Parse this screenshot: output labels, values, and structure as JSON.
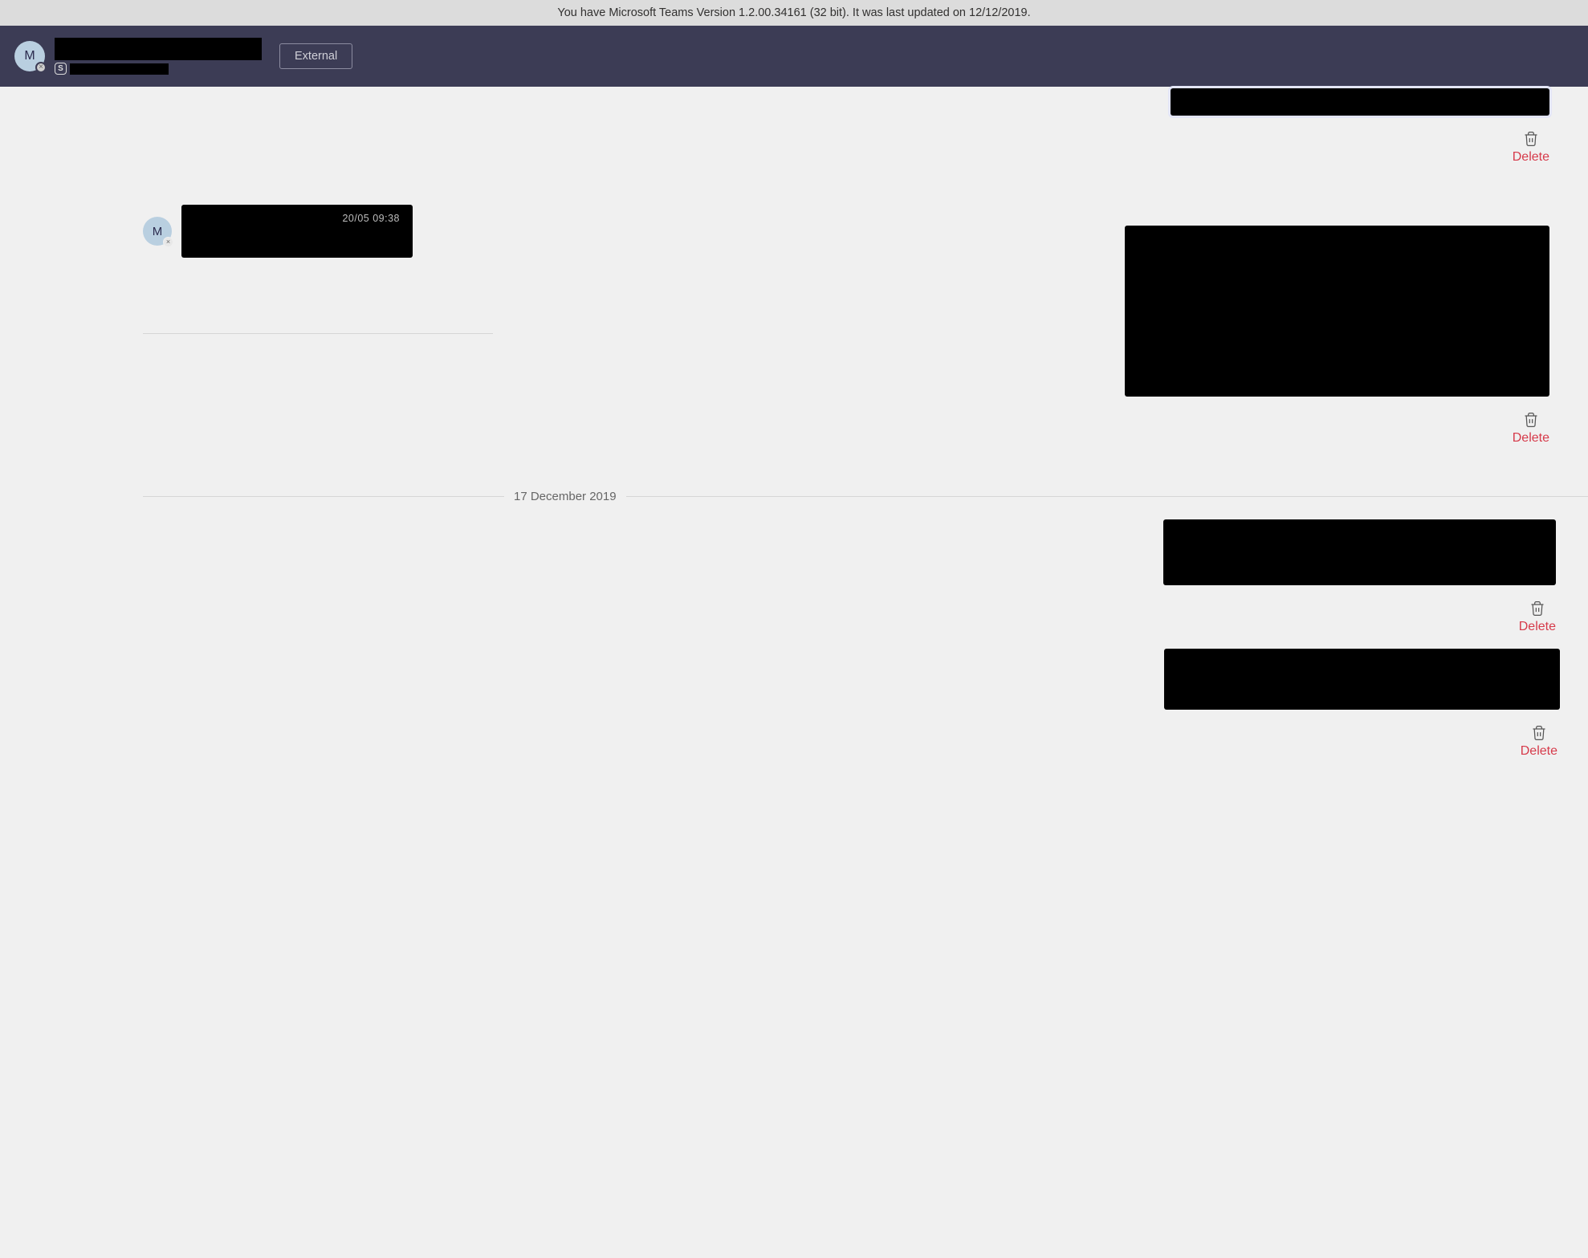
{
  "update_bar": {
    "text": "You have Microsoft Teams Version 1.2.00.34161 (32 bit). It was last updated on 12/12/2019."
  },
  "header": {
    "avatar_initial": "M",
    "external_label": "External"
  },
  "chat": {
    "messages": {
      "left1_time": "20/05 09:38"
    },
    "delete_label": "Delete",
    "date_divider": "17 December 2019",
    "avatar_initial_small": "M"
  }
}
